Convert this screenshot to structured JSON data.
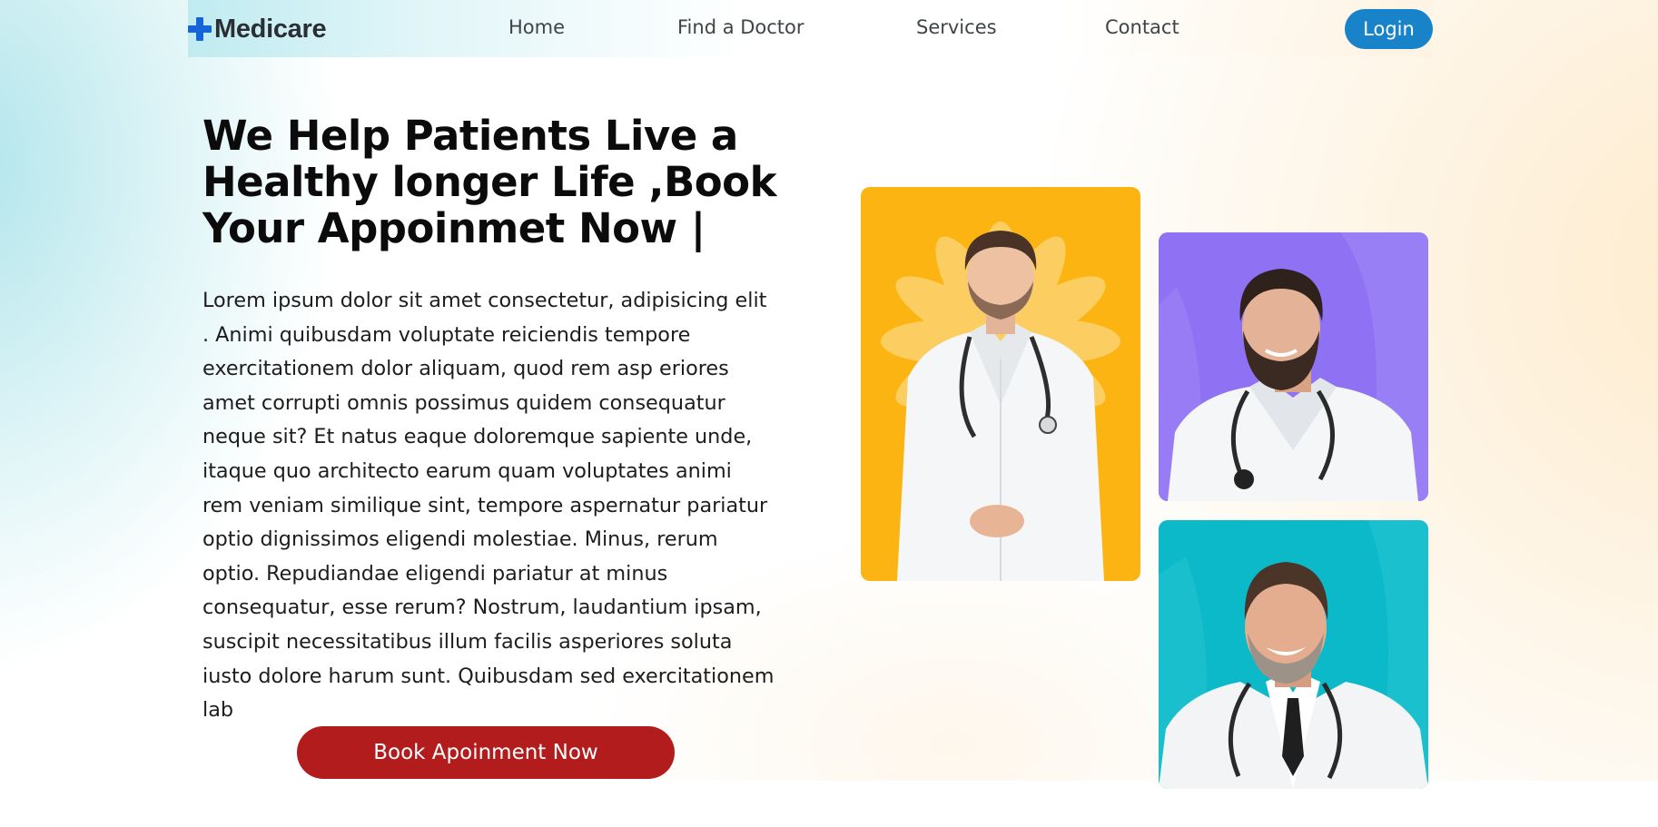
{
  "nav": {
    "logo_text": "Medicare",
    "logo_icon": "plus-cross-icon",
    "links": [
      {
        "label": "Home"
      },
      {
        "label": "Find a Doctor"
      },
      {
        "label": "Services"
      },
      {
        "label": "Contact"
      }
    ],
    "login_label": "Login"
  },
  "hero": {
    "title": "We Help Patients Live a Healthy longer Life ,Book Your Appoinmet Now |",
    "description": "Lorem ipsum dolor sit amet consectetur, adipisicing elit . Animi quibusdam voluptate reiciendis tempore exercitationem dolor aliquam, quod rem asp eriores amet corrupti omnis possimus quidem consequatur neque sit? Et natus eaque doloremque sapiente unde, itaque quo architecto earum quam voluptates animi rem veniam similique sint, tempore aspernatur pariatur optio dignissimos eligendi molestiae. Minus, rerum optio. Repudiandae eligendi pariatur at minus consequatur, esse rerum? Nostrum, laudantium ipsam, suscipit necessitatibus illum facilis asperiores soluta iusto dolore harum sunt. Quibusdam sed exercitationem lab",
    "cta_label": "Book Apoinment Now"
  },
  "doctor_cards": [
    {
      "background": "#fbb412",
      "pose": "standing-hands-clasped"
    },
    {
      "background": "#8f71f4",
      "pose": "portrait-beard"
    },
    {
      "background": "#0bb9c8",
      "pose": "portrait-smiling-tie"
    }
  ],
  "colors": {
    "brand_blue": "#1565d8",
    "login_blue": "#1883c9",
    "cta_red": "#b31c1c",
    "nav_text": "#3f4448"
  }
}
